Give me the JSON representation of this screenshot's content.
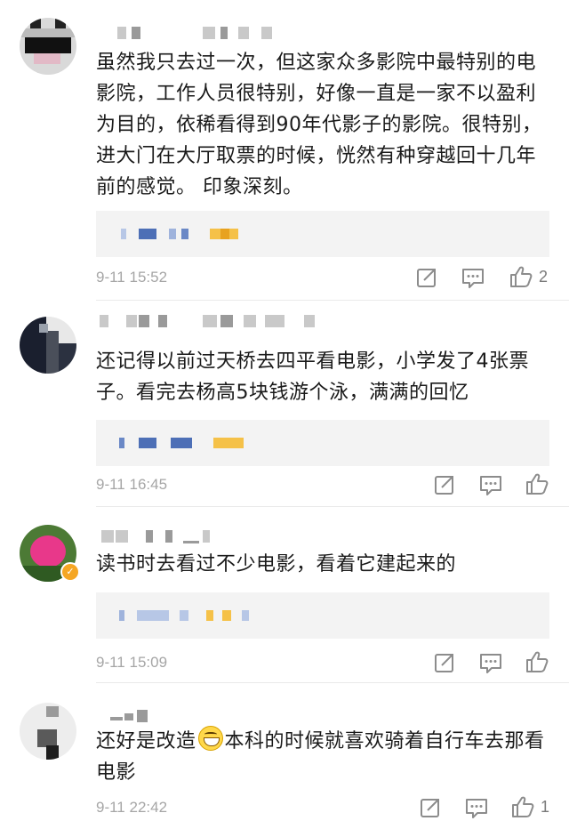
{
  "colors": {
    "background": "#ffffff",
    "text": "#1a1a1a",
    "timestamp": "#a6a6a6",
    "reply_box": "#f3f3f3",
    "icon": "#8c8c8c"
  },
  "comments": [
    {
      "text": "虽然我只去过一次，但这家众多影院中最特别的电影院，工作人员很特别，好像一直是一家不以盈利为目的，依稀看得到90年代影子的影院。很特别，进大门在大厅取票的时候，恍然有种穿越回十几年前的感觉。 印象深刻。",
      "time": "9-11 15:52",
      "likes": "2",
      "icons": [
        "share-icon",
        "comment-icon",
        "thumbs-up-icon"
      ]
    },
    {
      "text": "还记得以前过天桥去四平看电影，小学发了4张票子。看完去杨高5块钱游个泳，满满的回忆",
      "time": "9-11 16:45",
      "likes": "",
      "icons": [
        "share-icon",
        "comment-icon",
        "thumbs-up-icon"
      ]
    },
    {
      "text": "读书时去看过不少电影，看着它建起来的",
      "time": "9-11 15:09",
      "likes": "",
      "icons": [
        "share-icon",
        "comment-icon",
        "thumbs-up-icon"
      ]
    },
    {
      "text_before_emoji": "还好是改造",
      "emoji": "grinning-emoji",
      "text_after_emoji": "本科的时候就喜欢骑着自行车去那看电影",
      "time": "9-11 22:42",
      "likes": "1",
      "icons": [
        "share-icon",
        "comment-icon",
        "thumbs-up-icon"
      ]
    }
  ]
}
